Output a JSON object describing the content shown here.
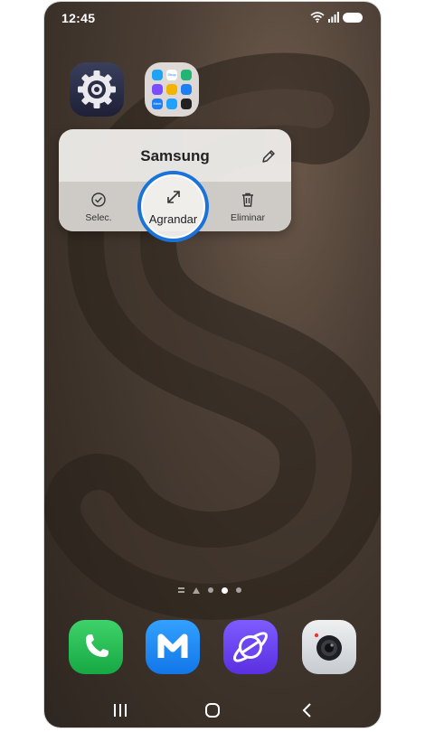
{
  "status_bar": {
    "time": "12:45"
  },
  "home_apps": [
    {
      "name": "settings-app-icon"
    },
    {
      "name": "folder-app-icon"
    }
  ],
  "folder_icon": {
    "mini_icons": [
      "#1ea3f5",
      "#ffffff",
      "#22b573",
      "#7a4dff",
      "#f3b400",
      "#1c7ff2",
      "#1c7ff2",
      "#1fa2ff",
      "#222222"
    ],
    "mini_texts": [
      "",
      "Shop",
      "",
      "",
      "",
      "",
      "Meet",
      "",
      ""
    ]
  },
  "popup": {
    "title": "Samsung",
    "actions": [
      {
        "label": "Selec.",
        "icon": "check-circle-icon"
      },
      {
        "label": "Agrandar",
        "icon": "expand-icon"
      },
      {
        "label": "Eliminar",
        "icon": "trash-icon"
      }
    ]
  },
  "page_indicator": {
    "pages": 3,
    "active_index": 2
  },
  "dock": [
    {
      "name": "phone-app",
      "icon": "phone-handset-icon"
    },
    {
      "name": "messages-app",
      "icon": "messages-m-icon"
    },
    {
      "name": "internet-app",
      "icon": "planet-icon"
    },
    {
      "name": "camera-app",
      "icon": "camera-icon"
    }
  ],
  "colors": {
    "highlight_ring": "#1a73d9",
    "wallpaper_dark": "#2e2620",
    "wallpaper_light": "#6e5a4c"
  }
}
